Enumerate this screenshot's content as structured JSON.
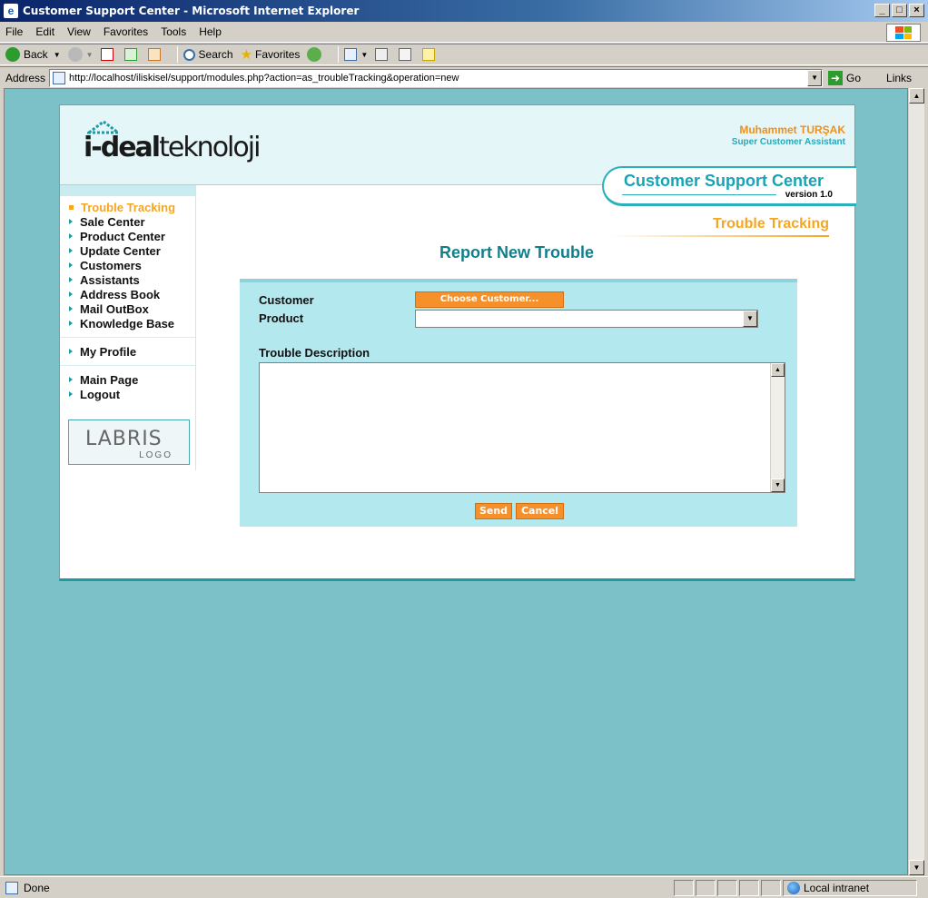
{
  "window": {
    "title": "Customer Support Center - Microsoft Internet Explorer"
  },
  "menu": [
    "File",
    "Edit",
    "View",
    "Favorites",
    "Tools",
    "Help"
  ],
  "toolbar": {
    "back": "Back",
    "search": "Search",
    "favorites": "Favorites"
  },
  "address": {
    "label": "Address",
    "url": "http://localhost/iliskisel/support/modules.php?action=as_troubleTracking&operation=new",
    "go": "Go",
    "links": "Links"
  },
  "header": {
    "logo_bold": "i-deal",
    "logo_regular": "teknoloji",
    "user_name": "Muhammet TURŞAK",
    "user_role": "Super Customer Assistant",
    "app_title": "Customer Support Center",
    "app_version": "version 1.0"
  },
  "sidebar": {
    "items": [
      {
        "label": "Trouble Tracking",
        "active": true
      },
      {
        "label": "Sale Center"
      },
      {
        "label": "Product Center"
      },
      {
        "label": "Update Center"
      },
      {
        "label": "Customers"
      },
      {
        "label": "Assistants"
      },
      {
        "label": "Address Book"
      },
      {
        "label": "Mail OutBox"
      },
      {
        "label": "Knowledge Base"
      }
    ],
    "profile": "My Profile",
    "main_page": "Main Page",
    "logout": "Logout",
    "badge_top": "LABRIS",
    "badge_bottom": "LOGO"
  },
  "section": {
    "title": "Trouble Tracking"
  },
  "form": {
    "title": "Report New Trouble",
    "customer_label": "Customer",
    "choose_customer": "Choose Customer...",
    "product_label": "Product",
    "product_value": "",
    "description_label": "Trouble Description",
    "description_value": "",
    "send": "Send",
    "cancel": "Cancel"
  },
  "status": {
    "text": "Done",
    "zone": "Local intranet"
  },
  "colors": {
    "accent": "#1d9ba3",
    "orange": "#f5902a",
    "page_bg": "#7bc1c7",
    "form_bg": "#b3e8ee"
  }
}
